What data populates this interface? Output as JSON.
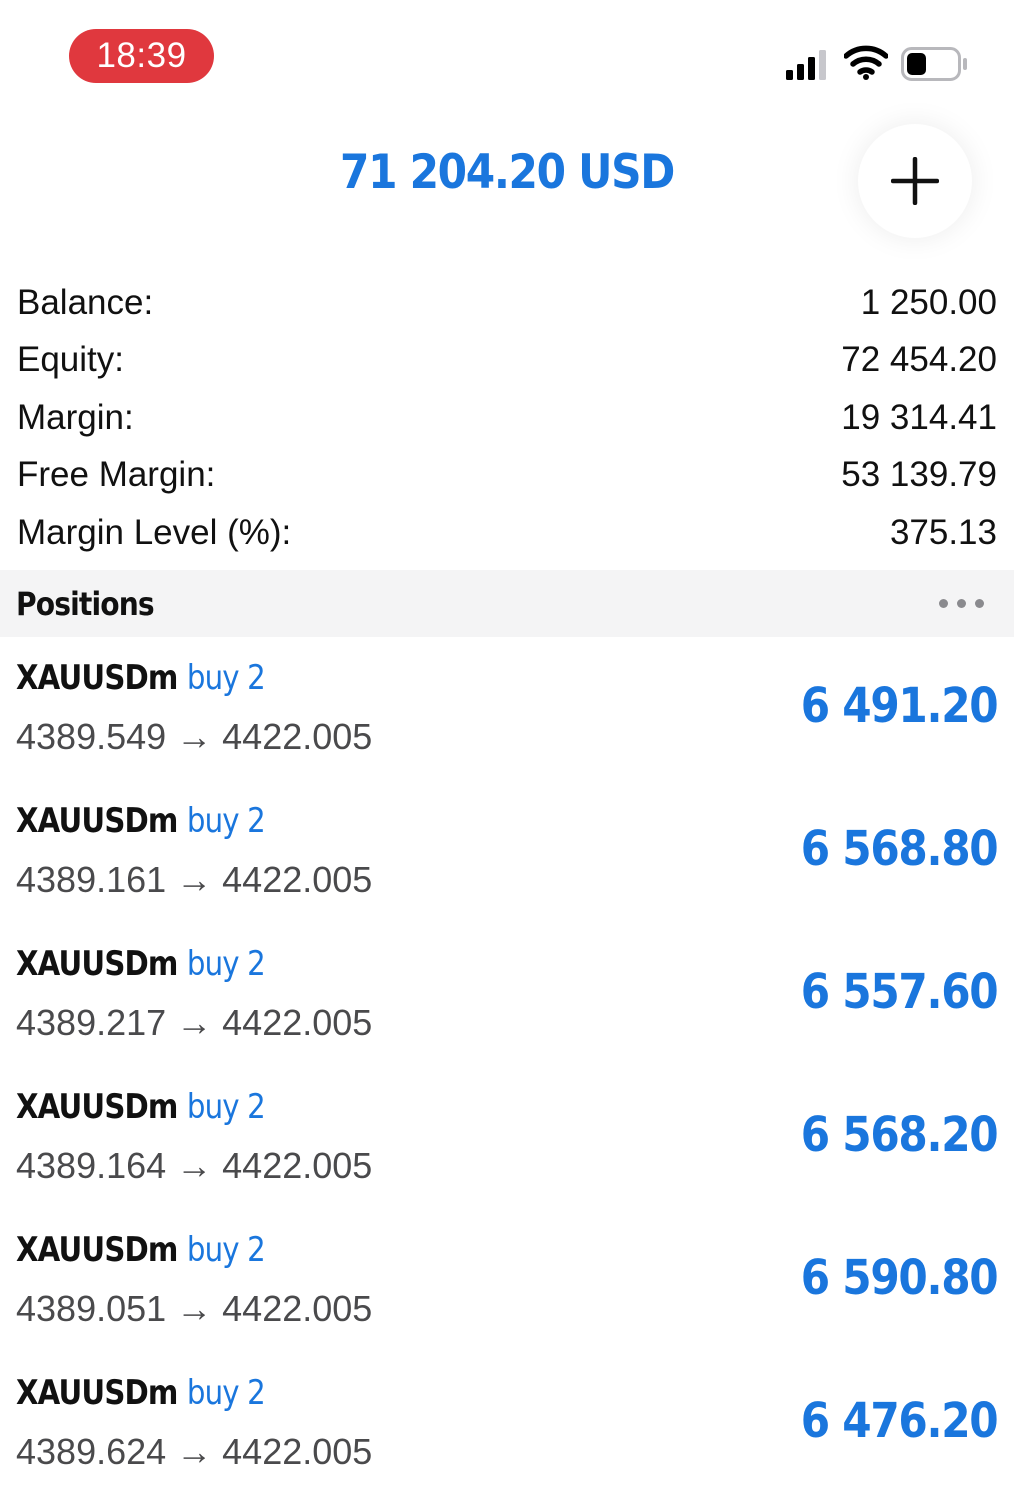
{
  "status_bar": {
    "time": "18:39",
    "icons": [
      "signal-icon",
      "wifi-icon",
      "battery-icon"
    ]
  },
  "header": {
    "total": "71 204.20 USD",
    "add_icon": "plus-icon"
  },
  "summary": [
    {
      "label": "Balance:",
      "value": "1 250.00"
    },
    {
      "label": "Equity:",
      "value": "72 454.20"
    },
    {
      "label": "Margin:",
      "value": "19 314.41"
    },
    {
      "label": "Free Margin:",
      "value": "53 139.79"
    },
    {
      "label": "Margin Level (%):",
      "value": "375.13"
    }
  ],
  "positions_section": {
    "title": "Positions",
    "more_icon": "more-dots-icon"
  },
  "positions": [
    {
      "symbol": "XAUUSDm",
      "type": "buy 2",
      "prices": "4389.549 → 4422.005",
      "profit": "6 491.20"
    },
    {
      "symbol": "XAUUSDm",
      "type": "buy 2",
      "prices": "4389.161 → 4422.005",
      "profit": "6 568.80"
    },
    {
      "symbol": "XAUUSDm",
      "type": "buy 2",
      "prices": "4389.217 → 4422.005",
      "profit": "6 557.60"
    },
    {
      "symbol": "XAUUSDm",
      "type": "buy 2",
      "prices": "4389.164 → 4422.005",
      "profit": "6 568.20"
    },
    {
      "symbol": "XAUUSDm",
      "type": "buy 2",
      "prices": "4389.051 → 4422.005",
      "profit": "6 590.80"
    },
    {
      "symbol": "XAUUSDm",
      "type": "buy 2",
      "prices": "4389.624 → 4422.005",
      "profit": "6 476.20"
    }
  ],
  "colors": {
    "accent": "#1a76dd",
    "time_pill": "#e0383e",
    "section_bg": "#f4f4f5"
  }
}
